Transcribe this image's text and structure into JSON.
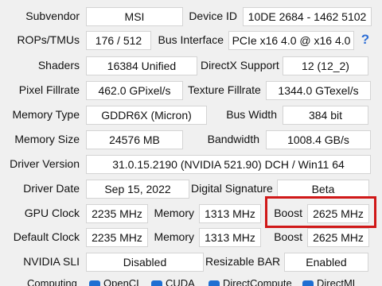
{
  "rows": {
    "subvendor": {
      "label": "Subvendor",
      "value": "MSI",
      "label2": "Device ID",
      "value2": "10DE 2684 - 1462 5102"
    },
    "rops": {
      "label": "ROPs/TMUs",
      "value": "176 / 512",
      "label2": "Bus Interface",
      "value2": "PCIe x16 4.0 @ x16 4.0"
    },
    "shaders": {
      "label": "Shaders",
      "value": "16384 Unified",
      "label2": "DirectX Support",
      "value2": "12 (12_2)"
    },
    "fillrate": {
      "label": "Pixel Fillrate",
      "value": "462.0 GPixel/s",
      "label2": "Texture Fillrate",
      "value2": "1344.0 GTexel/s"
    },
    "memtype": {
      "label": "Memory Type",
      "value": "GDDR6X (Micron)",
      "label2": "Bus Width",
      "value2": "384 bit"
    },
    "memsize": {
      "label": "Memory Size",
      "value": "24576 MB",
      "label2": "Bandwidth",
      "value2": "1008.4 GB/s"
    },
    "driver": {
      "label": "Driver Version",
      "value": "31.0.15.2190 (NVIDIA 521.90) DCH / Win11 64"
    },
    "driverdate": {
      "label": "Driver Date",
      "value": "Sep 15, 2022",
      "label2": "Digital Signature",
      "value2": "Beta"
    },
    "gpuclock": {
      "label": "GPU Clock",
      "value": "2235 MHz",
      "mem_label": "Memory",
      "mem_value": "1313 MHz",
      "boost_label": "Boost",
      "boost_value": "2625 MHz"
    },
    "defclock": {
      "label": "Default Clock",
      "value": "2235 MHz",
      "mem_label": "Memory",
      "mem_value": "1313 MHz",
      "boost_label": "Boost",
      "boost_value": "2625 MHz"
    },
    "sli": {
      "label": "NVIDIA SLI",
      "value": "Disabled",
      "label2": "Resizable BAR",
      "value2": "Enabled"
    }
  },
  "help_glyph": "?",
  "computing": {
    "label": "Computing",
    "items": [
      "OpenCL",
      "CUDA",
      "DirectCompute",
      "DirectML"
    ]
  },
  "colors": {
    "highlight": "#d01818",
    "help": "#2f6fd6",
    "checkbox": "#1f6fd2"
  }
}
